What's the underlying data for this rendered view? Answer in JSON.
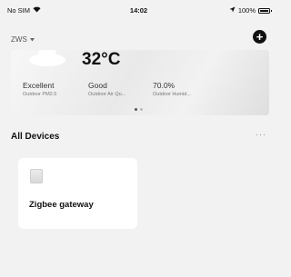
{
  "status_bar": {
    "carrier": "No SIM",
    "time": "14:02",
    "battery_percent": "100%"
  },
  "home": {
    "name": "ZWS",
    "add_button_label": "+"
  },
  "weather": {
    "temperature": "32°C",
    "metrics": [
      {
        "value": "Excellent",
        "label": "Outdoor PM2.5"
      },
      {
        "value": "Good",
        "label": "Outdoor Air Qu..."
      },
      {
        "value": "70.0%",
        "label": "Outdoor Humid..."
      }
    ],
    "pager_total": 2,
    "pager_active": 1
  },
  "devices_section": {
    "title": "All Devices",
    "more_label": "···"
  },
  "devices": [
    {
      "name": "Zigbee gateway"
    }
  ]
}
